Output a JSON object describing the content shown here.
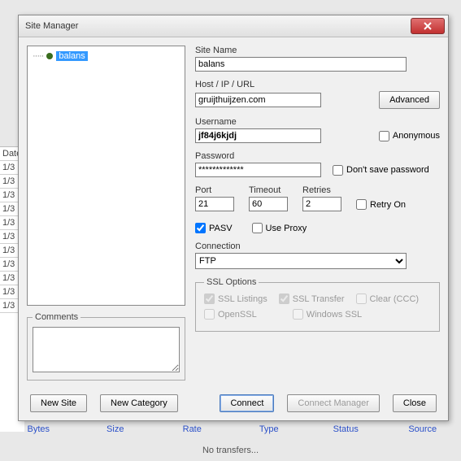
{
  "bg": {
    "dateHeader": "Date",
    "rows": [
      "1/3",
      "1/3",
      "1/3",
      "1/3",
      "1/3",
      "1/3",
      "1/3",
      "1/3",
      "1/3",
      "1/3",
      "1/3"
    ],
    "cols": [
      "Bytes",
      "Size",
      "Rate",
      "Type",
      "Status",
      "Source"
    ],
    "status": "No transfers..."
  },
  "win": {
    "title": "Site Manager"
  },
  "tree": {
    "item": "balans"
  },
  "commentsLegend": "Comments",
  "labels": {
    "siteName": "Site Name",
    "host": "Host / IP / URL",
    "username": "Username",
    "password": "Password",
    "port": "Port",
    "timeout": "Timeout",
    "retries": "Retries",
    "connection": "Connection",
    "sslOptions": "SSL Options"
  },
  "values": {
    "siteName": "balans",
    "host": "gruijthuijzen.com",
    "username": "jf84j6kjdj",
    "password": "*************",
    "port": "21",
    "timeout": "60",
    "retries": "2",
    "connection": "FTP"
  },
  "buttons": {
    "advanced": "Advanced",
    "newSite": "New Site",
    "newCategory": "New Category",
    "connect": "Connect",
    "connectMgr": "Connect Manager",
    "close": "Close"
  },
  "checks": {
    "anonymous": "Anonymous",
    "dontSavePw": "Don't save password",
    "retryOn": "Retry On",
    "pasv": "PASV",
    "useProxy": "Use Proxy",
    "sslListings": "SSL Listings",
    "sslTransfer": "SSL Transfer",
    "clearCCC": "Clear (CCC)",
    "openSSL": "OpenSSL",
    "windowsSSL": "Windows SSL"
  }
}
